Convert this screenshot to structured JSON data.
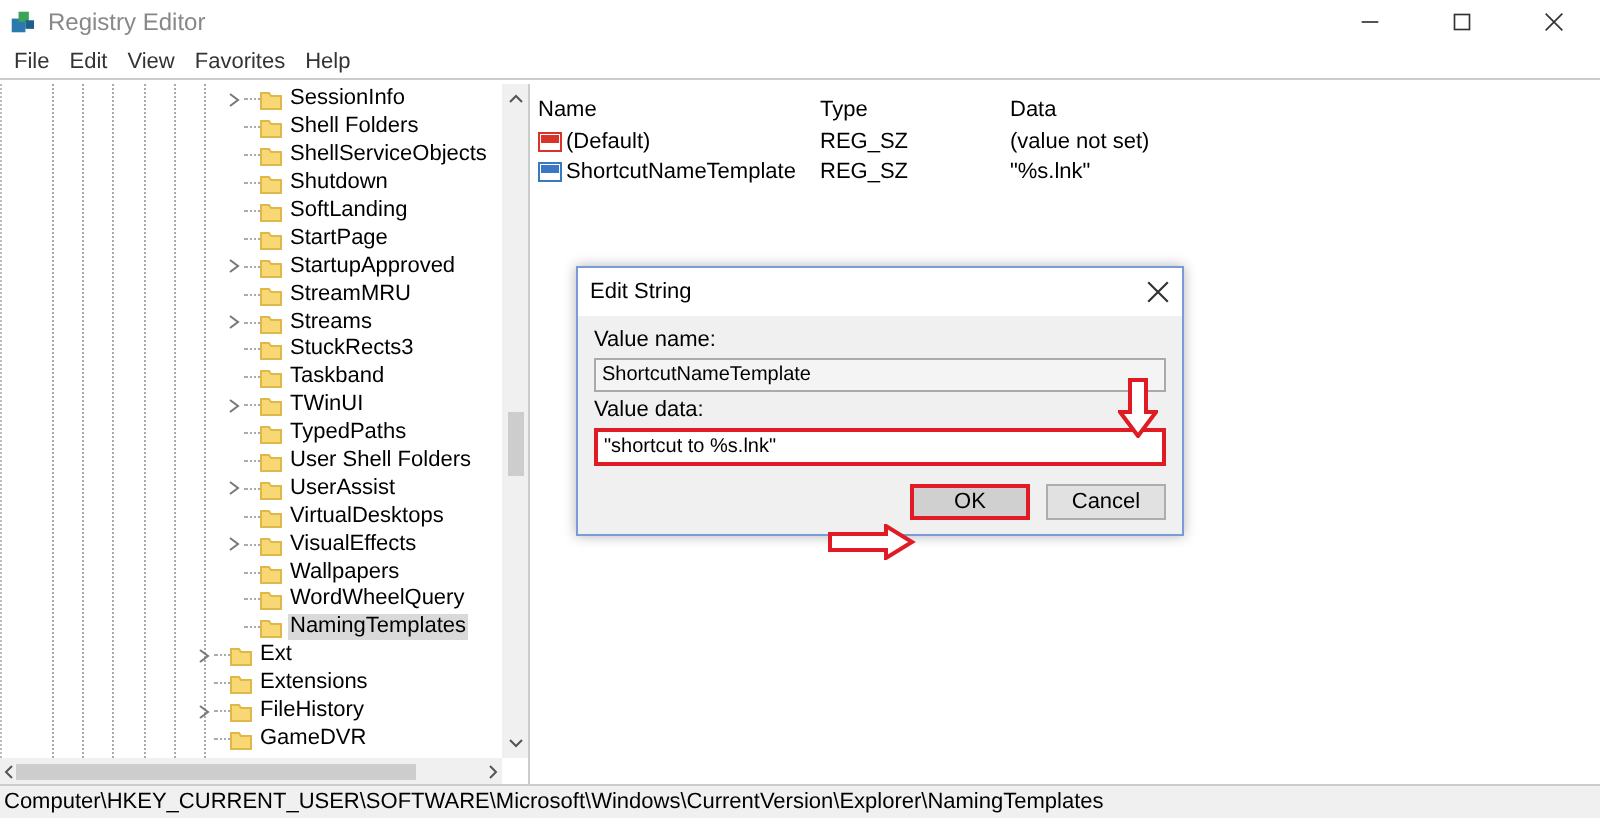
{
  "window": {
    "title": "Registry Editor"
  },
  "menu": [
    "File",
    "Edit",
    "View",
    "Favorites",
    "Help"
  ],
  "tree": {
    "nested_items": [
      {
        "label": "SessionInfo",
        "expandable": true,
        "selected": false
      },
      {
        "label": "Shell Folders",
        "expandable": false,
        "selected": false
      },
      {
        "label": "ShellServiceObjects",
        "expandable": false,
        "selected": false
      },
      {
        "label": "Shutdown",
        "expandable": false,
        "selected": false
      },
      {
        "label": "SoftLanding",
        "expandable": false,
        "selected": false
      },
      {
        "label": "StartPage",
        "expandable": false,
        "selected": false
      },
      {
        "label": "StartupApproved",
        "expandable": true,
        "selected": false
      },
      {
        "label": "StreamMRU",
        "expandable": false,
        "selected": false
      },
      {
        "label": "Streams",
        "expandable": true,
        "selected": false
      },
      {
        "label": "StuckRects3",
        "expandable": false,
        "selected": false
      },
      {
        "label": "Taskband",
        "expandable": false,
        "selected": false
      },
      {
        "label": "TWinUI",
        "expandable": true,
        "selected": false
      },
      {
        "label": "TypedPaths",
        "expandable": false,
        "selected": false
      },
      {
        "label": "User Shell Folders",
        "expandable": false,
        "selected": false
      },
      {
        "label": "UserAssist",
        "expandable": true,
        "selected": false
      },
      {
        "label": "VirtualDesktops",
        "expandable": false,
        "selected": false
      },
      {
        "label": "VisualEffects",
        "expandable": true,
        "selected": false
      },
      {
        "label": "Wallpapers",
        "expandable": false,
        "selected": false
      },
      {
        "label": "WordWheelQuery",
        "expandable": false,
        "selected": false
      },
      {
        "label": "NamingTemplates",
        "expandable": false,
        "selected": true
      }
    ],
    "items": [
      {
        "label": "Ext",
        "expandable": true,
        "selected": false
      },
      {
        "label": "Extensions",
        "expandable": false,
        "selected": false
      },
      {
        "label": "FileHistory",
        "expandable": true,
        "selected": false
      },
      {
        "label": "GameDVR",
        "expandable": false,
        "selected": false
      }
    ]
  },
  "table": {
    "columns": [
      "Name",
      "Type",
      "Data"
    ],
    "rows": [
      {
        "name": "(Default)",
        "type": "REG_SZ",
        "data": "(value not set)",
        "kind": "default"
      },
      {
        "name": "ShortcutNameTemplate",
        "type": "REG_SZ",
        "data": "\"%s.lnk\"",
        "kind": "string"
      }
    ]
  },
  "dialog": {
    "title": "Edit String",
    "value_name_label": "Value name:",
    "value_name": "ShortcutNameTemplate",
    "value_data_label": "Value data:",
    "value_data": "\"shortcut to %s.lnk\"",
    "buttons": [
      "OK",
      "Cancel"
    ]
  },
  "status_bar": "Computer\\HKEY_CURRENT_USER\\SOFTWARE\\Microsoft\\Windows\\CurrentVersion\\Explorer\\NamingTemplates"
}
